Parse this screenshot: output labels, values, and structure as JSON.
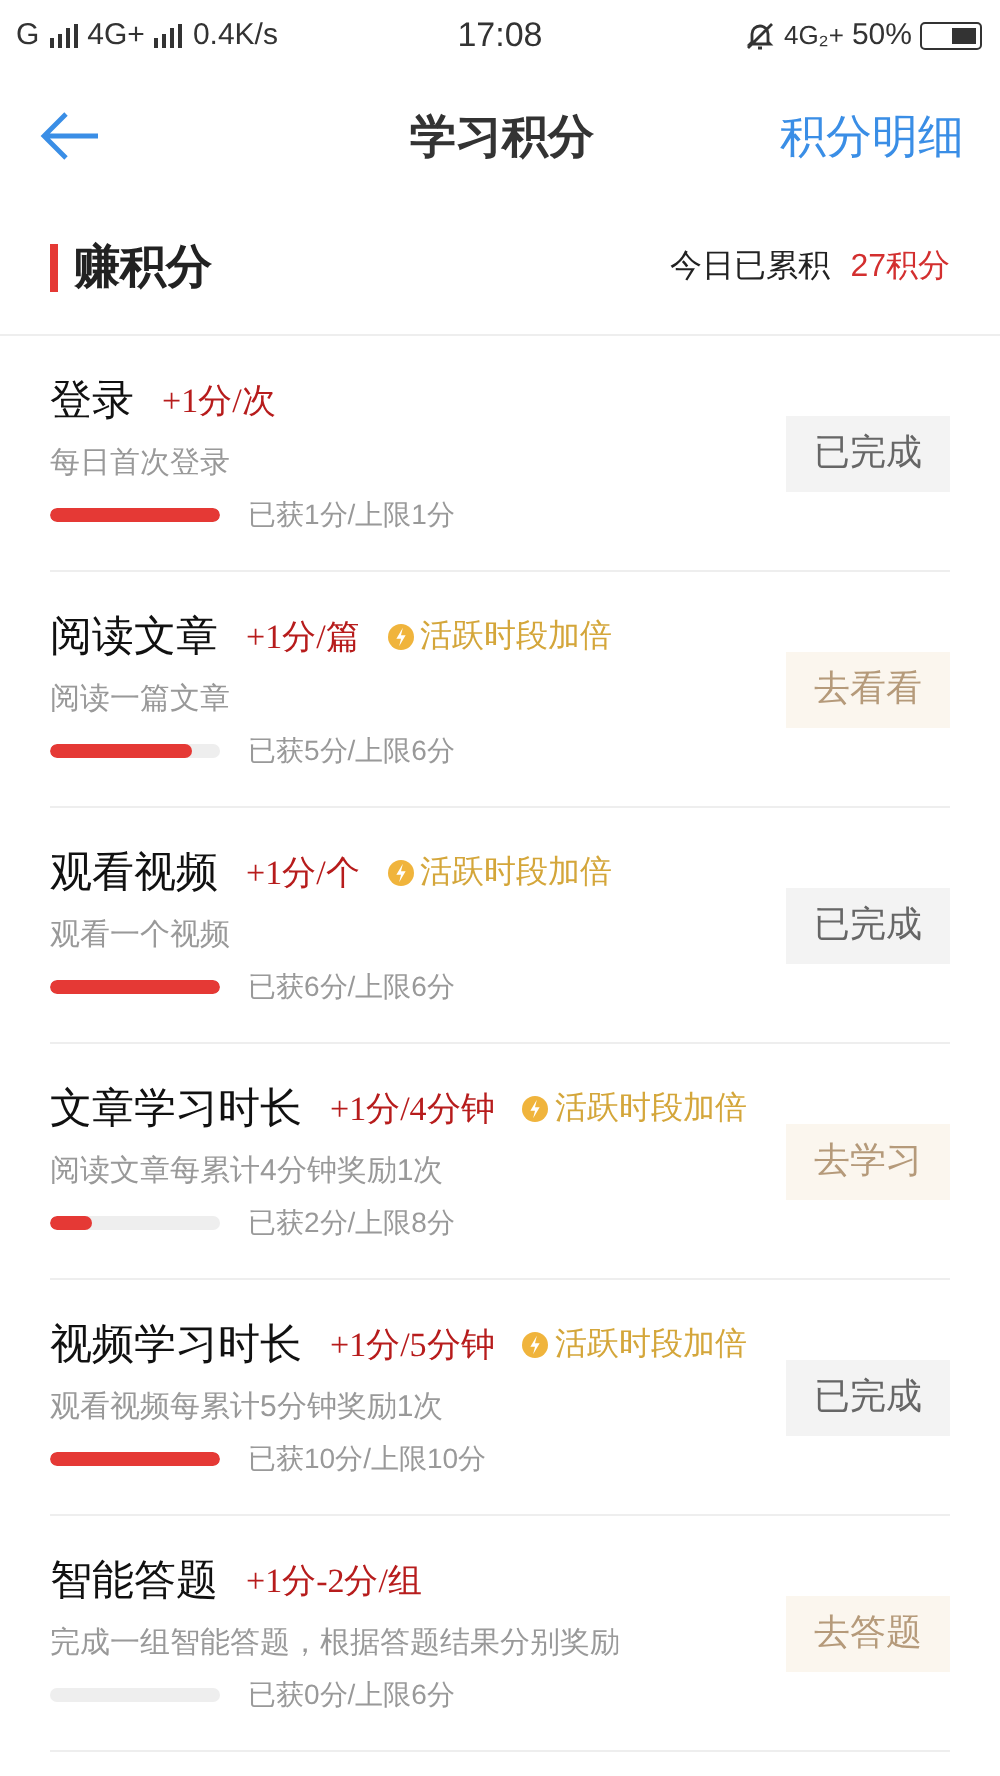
{
  "status_bar": {
    "carrier_left": "G",
    "network": "4G+",
    "speed": "0.4K/s",
    "time": "17:08",
    "network_right": "4G₂+",
    "battery": "50%"
  },
  "header": {
    "title": "学习积分",
    "action": "积分明细"
  },
  "section": {
    "title": "赚积分",
    "today_label": "今日已累积",
    "today_value": "27积分"
  },
  "tasks": [
    {
      "title": "登录",
      "reward": "+1分/次",
      "description": "每日首次登录",
      "level": 1,
      "progress": "已获1分/上限1分",
      "button": "已完成",
      "completed": true
    },
    {
      "title": "阅读文章",
      "reward": "+1分/篇",
      "bonus": "活跃时段加倍",
      "description": "阅读一篇文章",
      "level": 0.83,
      "progress": "已获5分/上限6分",
      "button": "去看看",
      "completed": false
    },
    {
      "title": "观看视频",
      "reward": "+1分/个",
      "bonus": "活跃时段加倍",
      "description": "观看一个视频",
      "level": 1,
      "progress": "已获6分/上限6分",
      "button": "已完成",
      "completed": true
    },
    {
      "title": "文章学习时长",
      "reward": "+1分/4分钟",
      "bonus": "活跃时段加倍",
      "description": "阅读文章每累计4分钟奖励1次",
      "level": 0.25,
      "progress": "已获2分/上限8分",
      "button": "去学习",
      "completed": false
    },
    {
      "title": "视频学习时长",
      "reward": "+1分/5分钟",
      "bonus": "活跃时段加倍",
      "description": "观看视频每累计5分钟奖励1次",
      "level": 1,
      "progress": "已获10分/上限10分",
      "button": "已完成",
      "completed": true
    },
    {
      "title": "智能答题",
      "reward": "+1分-2分/组",
      "description": "完成一组智能答题，根据答题结果分别奖励",
      "progress": "已获0分/上限6分",
      "button": "去答题",
      "completed": false
    }
  ]
}
